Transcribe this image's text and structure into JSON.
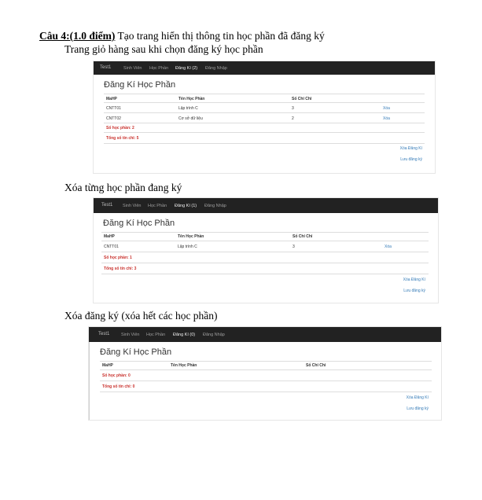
{
  "document": {
    "question_label": "Câu 4:(1.0 điểm)",
    "question_text": " Tạo trang hiển thị thông tin học phần đã đăng ký",
    "caption1": "Trang giỏ hàng sau khi chọn đăng ký học phần",
    "caption2": "Xóa từng học phần đang ký",
    "caption3": "Xóa đăng ký (xóa hết các học phần)"
  },
  "screens": [
    {
      "nav": {
        "brand": "Test1",
        "items": [
          "Sinh Viên",
          "Học Phần",
          "Đăng Kí (2)",
          "Đăng Nhập"
        ]
      },
      "title": "Đăng Kí Học Phần",
      "columns": [
        "MaHP",
        "Tên Học Phần",
        "Số Chỉ Chỉ"
      ],
      "rows": [
        {
          "code": "CNTT01",
          "name": "Lập trình C",
          "credits": "3",
          "delete": "Xóa"
        },
        {
          "code": "CNTT02",
          "name": "Cơ sở dữ liệu",
          "credits": "2",
          "delete": "Xóa"
        }
      ],
      "course_count": "Số học phần: 2",
      "credit_total": "Tổng số tín chỉ: 5",
      "clear_label": "Xóa Đăng Kí",
      "save_label": "Lưu đăng ký"
    },
    {
      "nav": {
        "brand": "Test1",
        "items": [
          "Sinh Viên",
          "Học Phần",
          "Đăng Kí (1)",
          "Đăng Nhập"
        ]
      },
      "title": "Đăng Kí Học Phần",
      "columns": [
        "MaHP",
        "Tên Học Phần",
        "Số Chỉ Chỉ"
      ],
      "rows": [
        {
          "code": "CNTT01",
          "name": "Lập trình C",
          "credits": "3",
          "delete": "Xóa"
        }
      ],
      "course_count": "Số học phần: 1",
      "credit_total": "Tổng số tín chỉ: 3",
      "clear_label": "Xóa Đăng Kí",
      "save_label": "Lưu đăng ký"
    },
    {
      "nav": {
        "brand": "Test1",
        "items": [
          "Sinh Viên",
          "Học Phần",
          "Đăng Kí (0)",
          "Đăng Nhập"
        ]
      },
      "title": "Đăng Kí Học Phần",
      "columns": [
        "MaHP",
        "Tên Học Phần",
        "Số Chỉ Chỉ"
      ],
      "rows": [],
      "course_count": "Số học phần: 0",
      "credit_total": "Tổng số tín chỉ: 0",
      "clear_label": "Xóa Đăng Kí",
      "save_label": "Lưu đăng ký"
    }
  ],
  "colors": {
    "navbar": "#222222",
    "link": "#337ab7",
    "summary": "#c9302c"
  }
}
